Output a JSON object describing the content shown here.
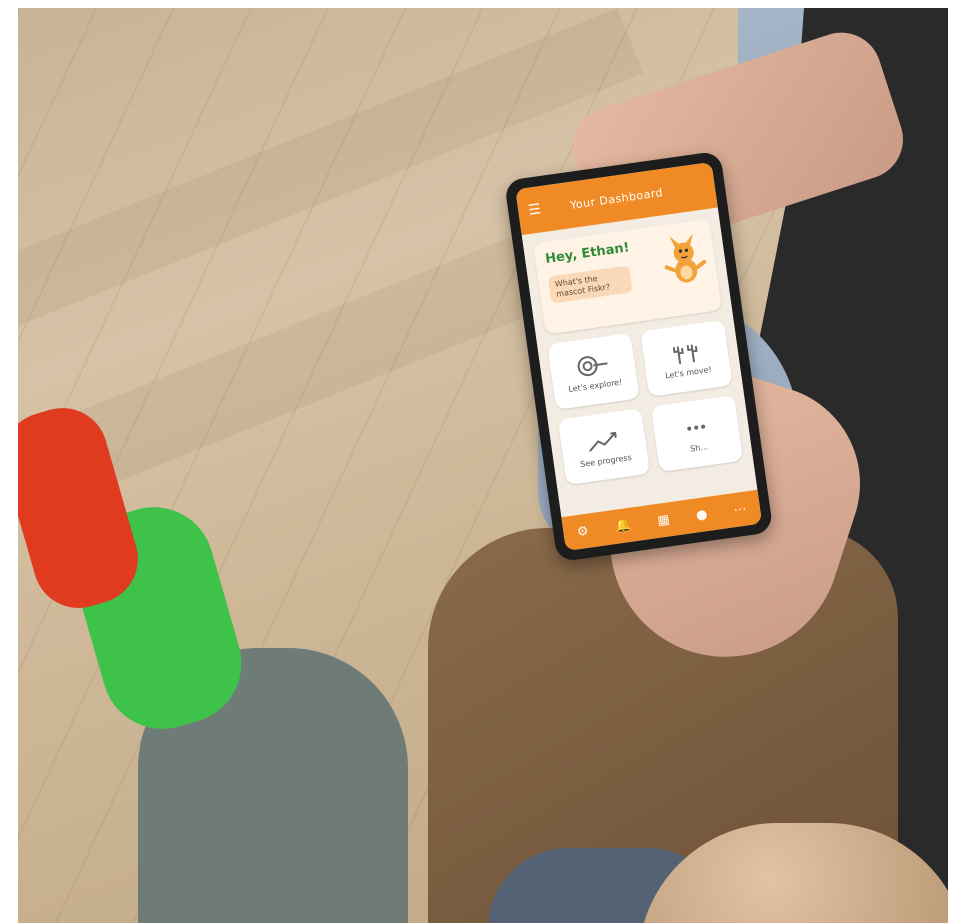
{
  "phone_app": {
    "topbar": {
      "title": "Your Dashboard",
      "menu_icon": "hamburger-icon"
    },
    "greeting": {
      "title": "Hey, Ethan!",
      "subtitle": "What's the mascot Fiskr?"
    },
    "tiles": [
      {
        "label": "Let's explore!",
        "icon": "target-icon"
      },
      {
        "label": "Let's move!",
        "icon": "cactus-icon"
      },
      {
        "label": "See progress",
        "icon": "trend-icon"
      },
      {
        "label": "Sh...",
        "icon": "more-icon"
      }
    ],
    "bottom_nav": [
      {
        "icon": "settings-icon"
      },
      {
        "icon": "bell-icon"
      },
      {
        "icon": "grid-icon"
      },
      {
        "icon": "avatar-icon"
      },
      {
        "icon": "more-icon"
      }
    ],
    "colors": {
      "accent": "#f08a24",
      "greeting": "#2f8b35"
    }
  }
}
